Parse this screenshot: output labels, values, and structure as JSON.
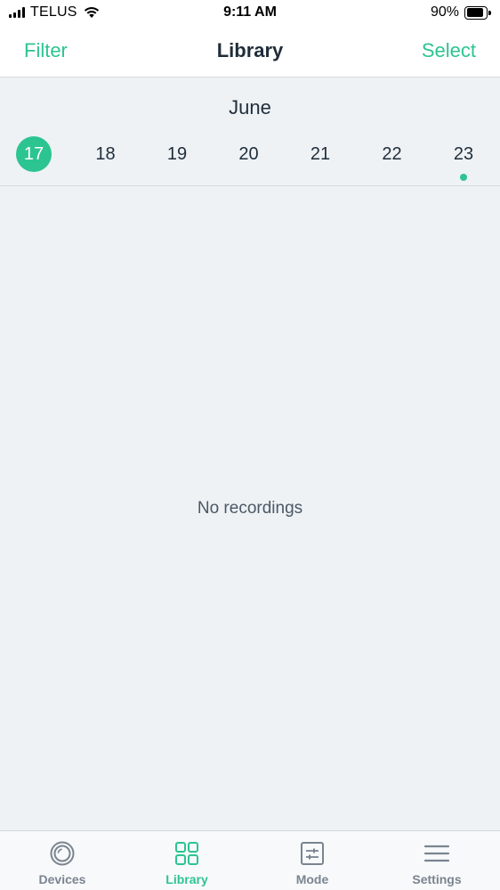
{
  "status_bar": {
    "carrier": "TELUS",
    "time": "9:11 AM",
    "battery_percent": "90%",
    "battery_level": 0.9
  },
  "nav": {
    "left": "Filter",
    "title": "Library",
    "right": "Select"
  },
  "calendar": {
    "month": "June",
    "days": [
      {
        "label": "17",
        "selected": true,
        "has_recordings": false
      },
      {
        "label": "18",
        "selected": false,
        "has_recordings": false
      },
      {
        "label": "19",
        "selected": false,
        "has_recordings": false
      },
      {
        "label": "20",
        "selected": false,
        "has_recordings": false
      },
      {
        "label": "21",
        "selected": false,
        "has_recordings": false
      },
      {
        "label": "22",
        "selected": false,
        "has_recordings": false
      },
      {
        "label": "23",
        "selected": false,
        "has_recordings": true
      }
    ]
  },
  "empty_state": "No recordings",
  "tabs": [
    {
      "label": "Devices",
      "icon": "camera-lens-icon",
      "active": false
    },
    {
      "label": "Library",
      "icon": "grid-icon",
      "active": true
    },
    {
      "label": "Mode",
      "icon": "sliders-icon",
      "active": false
    },
    {
      "label": "Settings",
      "icon": "menu-icon",
      "active": false
    }
  ],
  "colors": {
    "accent": "#2cc491",
    "background": "#eef2f5",
    "text": "#1f2d3a",
    "inactive_tab": "#7a8490"
  }
}
